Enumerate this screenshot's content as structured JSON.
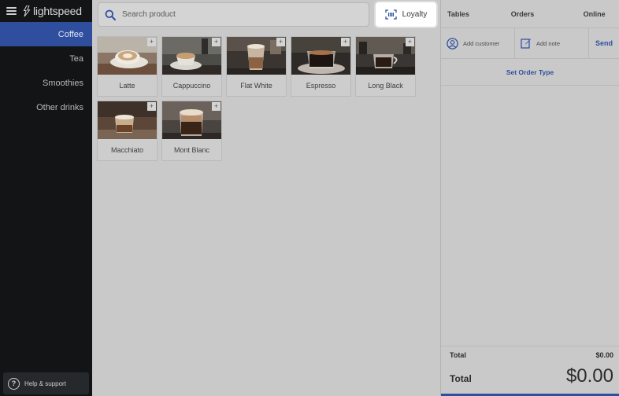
{
  "brand": {
    "name": "lightspeed"
  },
  "sidebar": {
    "categories": [
      {
        "label": "Coffee",
        "active": true
      },
      {
        "label": "Tea",
        "active": false
      },
      {
        "label": "Smoothies",
        "active": false
      },
      {
        "label": "Other drinks",
        "active": false
      }
    ],
    "help_label": "Help & support"
  },
  "search": {
    "placeholder": "Search product"
  },
  "loyalty": {
    "label": "Loyalty"
  },
  "products": [
    {
      "name": "Latte"
    },
    {
      "name": "Cappuccino"
    },
    {
      "name": "Flat White"
    },
    {
      "name": "Espresso"
    },
    {
      "name": "Long Black"
    },
    {
      "name": "Macchiato"
    },
    {
      "name": "Mont Blanc"
    }
  ],
  "tile_plus": "+",
  "panel": {
    "tabs": [
      "Tables",
      "Orders",
      "Online"
    ],
    "add_customer": "Add customer",
    "add_note": "Add note",
    "send": "Send",
    "order_type": "Set Order Type",
    "subtotal_label": "Total",
    "subtotal_value": "$0.00",
    "total_label": "Total",
    "total_value": "$0.00"
  },
  "colors": {
    "accent": "#2f4e9e",
    "sidebar_bg": "#121416"
  }
}
